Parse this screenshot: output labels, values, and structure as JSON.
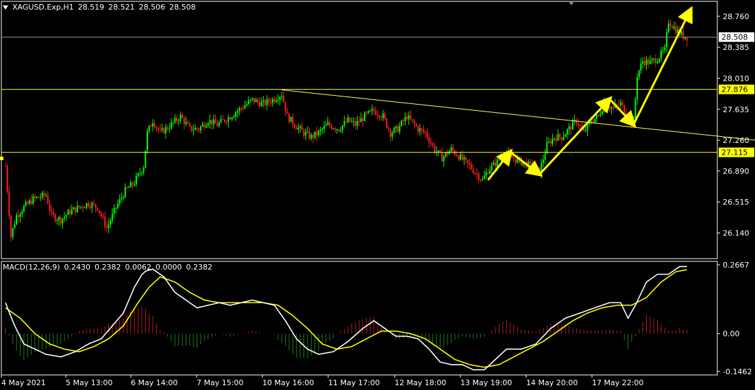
{
  "symbol": "XAGUSD.Exp,H1",
  "ohlc": [
    "28.519",
    "28.521",
    "28.506",
    "28.508"
  ],
  "macd_label": "MACD(12,26,9)",
  "macd_values": [
    "0.2430",
    "0.2382",
    "0.0062",
    "0.0000",
    "0.2382"
  ],
  "colors": {
    "background": "#000000",
    "bull": "#00ff00",
    "bear": "#ff2020",
    "horizontal_level": "#ffff00",
    "trendline": "#ffff66",
    "arrow": "#ffff00",
    "macd_line": "#ffffff",
    "signal_line": "#ffff00",
    "hist_up": "#b02020",
    "hist_down": "#207a20",
    "axis": "#ffffff"
  },
  "chart_data": [
    {
      "type": "candlestick",
      "title": "XAGUSD.Exp,H1",
      "price_ticks": [
        "28.760",
        "28.385",
        "28.010",
        "27.635",
        "27.260",
        "26.890",
        "26.515",
        "26.140"
      ],
      "ylim": [
        25.83,
        28.94
      ],
      "current_price": "28.508",
      "horizontal_levels": [
        "27.876",
        "27.115"
      ],
      "x_tick_labels": [
        "4 May 2021",
        "5 May 13:00",
        "6 May 14:00",
        "7 May 15:00",
        "10 May 16:00",
        "11 May 17:00",
        "12 May 18:00",
        "13 May 19:00",
        "14 May 20:00",
        "17 May 22:00"
      ],
      "grid": false,
      "trendline": [
        {
          "bar": 150,
          "price": 27.87
        },
        {
          "bar": 425,
          "price": 27.22
        }
      ],
      "arrows": [
        [
          {
            "bar": 262,
            "price": 26.78
          },
          {
            "bar": 274,
            "price": 27.12
          }
        ],
        [
          {
            "bar": 274,
            "price": 27.12
          },
          {
            "bar": 290,
            "price": 26.85
          }
        ],
        [
          {
            "bar": 290,
            "price": 26.85
          },
          {
            "bar": 328,
            "price": 27.76
          }
        ],
        [
          {
            "bar": 328,
            "price": 27.76
          },
          {
            "bar": 341,
            "price": 27.45
          }
        ],
        [
          {
            "bar": 341,
            "price": 27.45
          },
          {
            "bar": 372,
            "price": 28.84
          }
        ]
      ],
      "price_path": [
        [
          0,
          26.95
        ],
        [
          3,
          26.1
        ],
        [
          6,
          26.35
        ],
        [
          10,
          26.45
        ],
        [
          15,
          26.55
        ],
        [
          22,
          26.6
        ],
        [
          25,
          26.35
        ],
        [
          30,
          26.3
        ],
        [
          35,
          26.4
        ],
        [
          40,
          26.45
        ],
        [
          45,
          26.5
        ],
        [
          50,
          26.45
        ],
        [
          55,
          26.2
        ],
        [
          60,
          26.45
        ],
        [
          65,
          26.65
        ],
        [
          70,
          26.75
        ],
        [
          75,
          26.95
        ],
        [
          77,
          27.35
        ],
        [
          80,
          27.5
        ],
        [
          84,
          27.35
        ],
        [
          90,
          27.45
        ],
        [
          95,
          27.55
        ],
        [
          100,
          27.4
        ],
        [
          105,
          27.4
        ],
        [
          110,
          27.5
        ],
        [
          115,
          27.45
        ],
        [
          122,
          27.55
        ],
        [
          128,
          27.65
        ],
        [
          134,
          27.75
        ],
        [
          140,
          27.7
        ],
        [
          145,
          27.75
        ],
        [
          150,
          27.82
        ],
        [
          153,
          27.55
        ],
        [
          157,
          27.45
        ],
        [
          162,
          27.35
        ],
        [
          166,
          27.3
        ],
        [
          170,
          27.35
        ],
        [
          175,
          27.45
        ],
        [
          181,
          27.4
        ],
        [
          186,
          27.5
        ],
        [
          190,
          27.45
        ],
        [
          195,
          27.55
        ],
        [
          200,
          27.62
        ],
        [
          205,
          27.55
        ],
        [
          209,
          27.35
        ],
        [
          213,
          27.4
        ],
        [
          218,
          27.55
        ],
        [
          224,
          27.4
        ],
        [
          228,
          27.35
        ],
        [
          233,
          27.15
        ],
        [
          237,
          27.05
        ],
        [
          242,
          27.15
        ],
        [
          247,
          27.05
        ],
        [
          252,
          26.95
        ],
        [
          256,
          26.85
        ],
        [
          259,
          26.78
        ],
        [
          262,
          26.9
        ],
        [
          267,
          27.0
        ],
        [
          271,
          27.1
        ],
        [
          275,
          27.05
        ],
        [
          280,
          27.0
        ],
        [
          285,
          26.95
        ],
        [
          290,
          26.88
        ],
        [
          294,
          27.2
        ],
        [
          298,
          27.3
        ],
        [
          302,
          27.3
        ],
        [
          306,
          27.4
        ],
        [
          310,
          27.5
        ],
        [
          314,
          27.35
        ],
        [
          318,
          27.5
        ],
        [
          322,
          27.55
        ],
        [
          325,
          27.7
        ],
        [
          330,
          27.65
        ],
        [
          334,
          27.7
        ],
        [
          338,
          27.55
        ],
        [
          341,
          27.47
        ],
        [
          343,
          28.05
        ],
        [
          346,
          28.22
        ],
        [
          350,
          28.2
        ],
        [
          354,
          28.25
        ],
        [
          358,
          28.35
        ],
        [
          360,
          28.7
        ],
        [
          364,
          28.6
        ],
        [
          368,
          28.52
        ],
        [
          370,
          28.508
        ]
      ]
    },
    {
      "type": "macd",
      "title": "MACD(12,26,9)",
      "y_ticks": [
        "0.2667",
        "0.00",
        "-0.1462"
      ],
      "ylim": [
        -0.16,
        0.28
      ],
      "macd_path": [
        [
          0,
          0.12
        ],
        [
          5,
          0.03
        ],
        [
          10,
          -0.04
        ],
        [
          16,
          -0.06
        ],
        [
          22,
          -0.08
        ],
        [
          30,
          -0.09
        ],
        [
          38,
          -0.07
        ],
        [
          45,
          -0.04
        ],
        [
          52,
          -0.02
        ],
        [
          58,
          0.03
        ],
        [
          64,
          0.08
        ],
        [
          70,
          0.18
        ],
        [
          75,
          0.24
        ],
        [
          80,
          0.25
        ],
        [
          86,
          0.22
        ],
        [
          92,
          0.16
        ],
        [
          98,
          0.13
        ],
        [
          104,
          0.1
        ],
        [
          110,
          0.11
        ],
        [
          116,
          0.12
        ],
        [
          122,
          0.11
        ],
        [
          128,
          0.12
        ],
        [
          134,
          0.13
        ],
        [
          140,
          0.12
        ],
        [
          146,
          0.11
        ],
        [
          152,
          0.05
        ],
        [
          158,
          -0.02
        ],
        [
          164,
          -0.06
        ],
        [
          170,
          -0.08
        ],
        [
          178,
          -0.07
        ],
        [
          186,
          -0.03
        ],
        [
          194,
          0.02
        ],
        [
          200,
          0.05
        ],
        [
          206,
          0.02
        ],
        [
          212,
          -0.01
        ],
        [
          218,
          -0.01
        ],
        [
          224,
          -0.02
        ],
        [
          230,
          -0.06
        ],
        [
          236,
          -0.11
        ],
        [
          242,
          -0.12
        ],
        [
          248,
          -0.12
        ],
        [
          254,
          -0.14
        ],
        [
          260,
          -0.14
        ],
        [
          266,
          -0.1
        ],
        [
          272,
          -0.06
        ],
        [
          280,
          -0.06
        ],
        [
          288,
          -0.04
        ],
        [
          296,
          0.02
        ],
        [
          304,
          0.06
        ],
        [
          312,
          0.08
        ],
        [
          320,
          0.1
        ],
        [
          328,
          0.12
        ],
        [
          334,
          0.12
        ],
        [
          338,
          0.06
        ],
        [
          342,
          0.11
        ],
        [
          348,
          0.2
        ],
        [
          354,
          0.23
        ],
        [
          360,
          0.23
        ],
        [
          366,
          0.26
        ],
        [
          372,
          0.26
        ]
      ],
      "signal_path": [
        [
          0,
          0.1
        ],
        [
          8,
          0.06
        ],
        [
          16,
          0.0
        ],
        [
          24,
          -0.04
        ],
        [
          32,
          -0.06
        ],
        [
          40,
          -0.07
        ],
        [
          48,
          -0.05
        ],
        [
          56,
          -0.02
        ],
        [
          64,
          0.03
        ],
        [
          72,
          0.12
        ],
        [
          78,
          0.18
        ],
        [
          84,
          0.22
        ],
        [
          92,
          0.2
        ],
        [
          100,
          0.16
        ],
        [
          108,
          0.13
        ],
        [
          116,
          0.12
        ],
        [
          124,
          0.12
        ],
        [
          132,
          0.12
        ],
        [
          140,
          0.12
        ],
        [
          148,
          0.11
        ],
        [
          156,
          0.07
        ],
        [
          164,
          0.02
        ],
        [
          172,
          -0.04
        ],
        [
          180,
          -0.06
        ],
        [
          188,
          -0.05
        ],
        [
          196,
          -0.02
        ],
        [
          204,
          0.01
        ],
        [
          212,
          0.01
        ],
        [
          220,
          0.0
        ],
        [
          228,
          -0.02
        ],
        [
          236,
          -0.06
        ],
        [
          244,
          -0.1
        ],
        [
          252,
          -0.12
        ],
        [
          260,
          -0.13
        ],
        [
          268,
          -0.12
        ],
        [
          276,
          -0.09
        ],
        [
          284,
          -0.06
        ],
        [
          292,
          -0.03
        ],
        [
          300,
          0.01
        ],
        [
          308,
          0.05
        ],
        [
          316,
          0.08
        ],
        [
          324,
          0.1
        ],
        [
          332,
          0.11
        ],
        [
          340,
          0.11
        ],
        [
          348,
          0.14
        ],
        [
          356,
          0.2
        ],
        [
          364,
          0.24
        ],
        [
          372,
          0.25
        ]
      ]
    }
  ]
}
